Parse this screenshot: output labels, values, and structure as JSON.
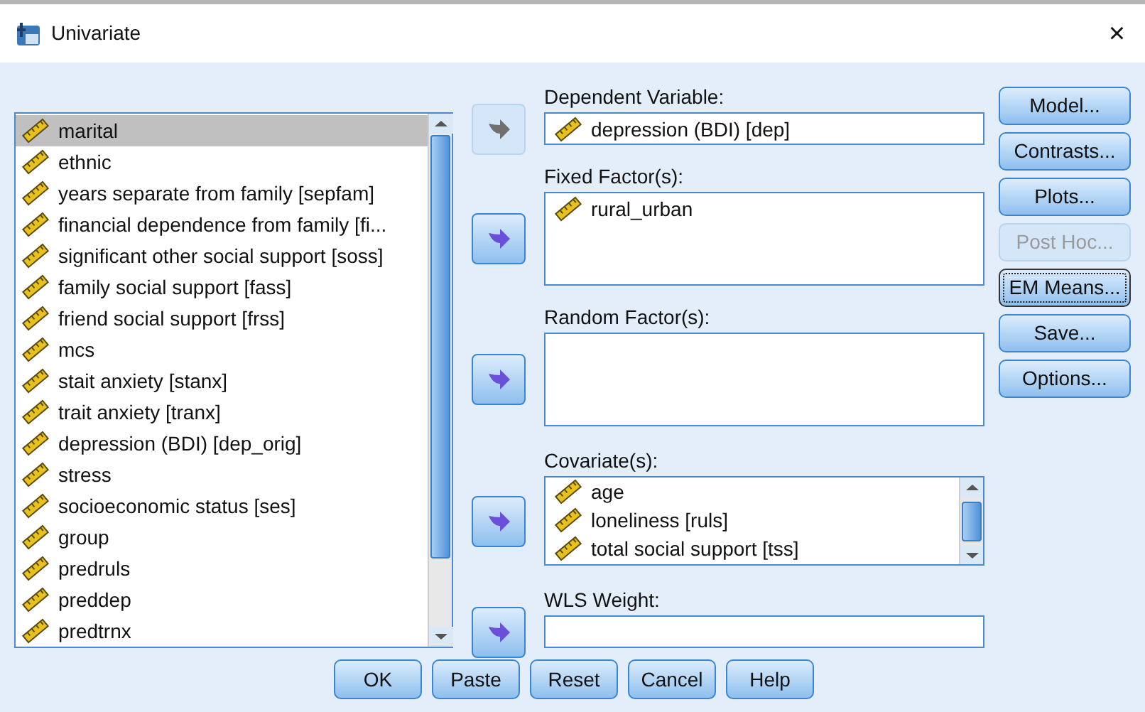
{
  "window": {
    "title": "Univariate",
    "close": "×"
  },
  "variables": [
    {
      "label": "marital",
      "selected": true
    },
    {
      "label": "ethnic",
      "selected": false
    },
    {
      "label": "years separate from family [sepfam]",
      "selected": false
    },
    {
      "label": "financial dependence from family [fi...",
      "selected": false
    },
    {
      "label": "significant other social support [soss]",
      "selected": false
    },
    {
      "label": "family social support [fass]",
      "selected": false
    },
    {
      "label": "friend social support [frss]",
      "selected": false
    },
    {
      "label": "mcs",
      "selected": false
    },
    {
      "label": "stait anxiety [stanx]",
      "selected": false
    },
    {
      "label": "trait anxiety [tranx]",
      "selected": false
    },
    {
      "label": "depression (BDI) [dep_orig]",
      "selected": false
    },
    {
      "label": "stress",
      "selected": false
    },
    {
      "label": "socioeconomic status [ses]",
      "selected": false
    },
    {
      "label": "group",
      "selected": false
    },
    {
      "label": "predruls",
      "selected": false
    },
    {
      "label": "preddep",
      "selected": false
    },
    {
      "label": "predtrnx",
      "selected": false
    }
  ],
  "targets": [
    {
      "kind": "single",
      "label": "Dependent Variable:",
      "arrow_disabled": true,
      "items": [
        "depression (BDI) [dep]"
      ]
    },
    {
      "kind": "list",
      "label": "Fixed Factor(s):",
      "arrow_disabled": false,
      "items": [
        "rural_urban"
      ]
    },
    {
      "kind": "list",
      "label": "Random Factor(s):",
      "arrow_disabled": false
    },
    {
      "kind": "scroll",
      "label": "Covariate(s):",
      "arrow_disabled": false,
      "items": [
        "age",
        "loneliness [ruls]",
        "total social support [tss]"
      ]
    },
    {
      "kind": "single",
      "label": "WLS Weight:",
      "arrow_disabled": false
    }
  ],
  "side_buttons": [
    {
      "label": "Model...",
      "disabled": false,
      "focused": false
    },
    {
      "label": "Contrasts...",
      "disabled": false,
      "focused": false
    },
    {
      "label": "Plots...",
      "disabled": false,
      "focused": false
    },
    {
      "label": "Post Hoc...",
      "disabled": true,
      "focused": false
    },
    {
      "label": "EM Means...",
      "disabled": false,
      "focused": true
    },
    {
      "label": "Save...",
      "disabled": false,
      "focused": false
    },
    {
      "label": "Options...",
      "disabled": false,
      "focused": false
    }
  ],
  "buttons": [
    "OK",
    "Paste",
    "Reset",
    "Cancel",
    "Help"
  ]
}
